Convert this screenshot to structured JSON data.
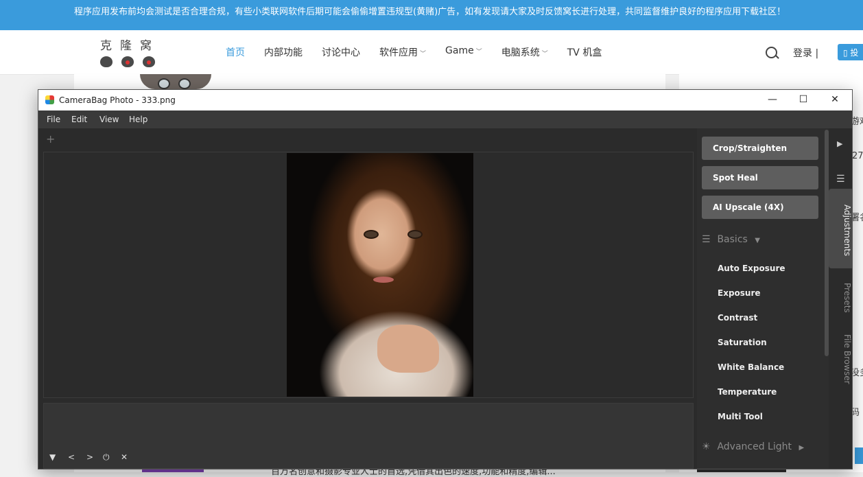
{
  "notice": "程序应用发布前均会测试是否合理合规，有些小类联网软件后期可能会偷偷增置违规型(黄赌)广告，如有发现请大家及时反馈窝长进行处理，共同监督维护良好的程序应用下载社区！",
  "site": {
    "logo_text": "克隆窝",
    "nav": [
      {
        "label": "首页",
        "active": true,
        "dropdown": false
      },
      {
        "label": "内部功能",
        "dropdown": false
      },
      {
        "label": "讨论中心",
        "dropdown": false
      },
      {
        "label": "软件应用",
        "dropdown": true
      },
      {
        "label": "Game",
        "dropdown": true
      },
      {
        "label": "电脑系统",
        "dropdown": true
      },
      {
        "label": "TV 机盒",
        "dropdown": false
      }
    ],
    "login": "登录",
    "post_button": "投",
    "side_fragments": [
      "游戏",
      "27",
      "署名",
      "没多",
      "码"
    ],
    "bottom_text": "百万名创意和摄影专业人士的首选,凭借其出色的速度,功能和精度,编辑..."
  },
  "app": {
    "title": "CameraBag Photo - 333.png",
    "menu": [
      "File",
      "Edit",
      "View",
      "Help"
    ],
    "plus": "+",
    "window_controls": {
      "minimize": "—",
      "maximize": "☐",
      "close": "✕"
    },
    "tools": [
      "Crop/Straighten",
      "Spot Heal",
      "AI Upscale (4X)"
    ],
    "basics_label": "Basics",
    "adjustments": [
      "Auto Exposure",
      "Exposure",
      "Contrast",
      "Saturation",
      "White Balance",
      "Temperature",
      "Multi Tool"
    ],
    "advanced_label": "Advanced Light",
    "side_tabs": [
      {
        "label": "Adjustments",
        "active": true
      },
      {
        "label": "Presets",
        "active": false
      },
      {
        "label": "File Browser",
        "active": false
      }
    ],
    "bottom_controls": [
      "▼",
      "<",
      ">",
      "⏻",
      "✕"
    ]
  }
}
